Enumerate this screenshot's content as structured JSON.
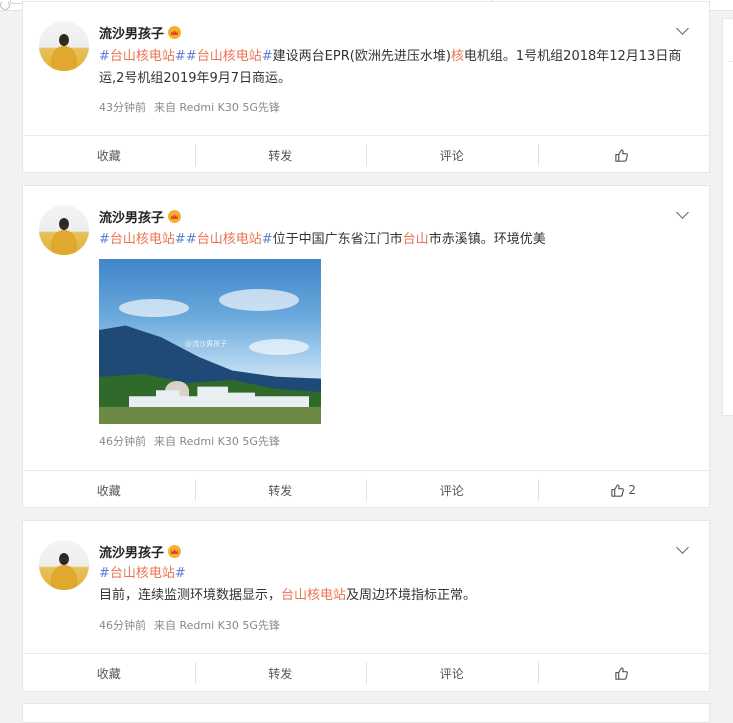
{
  "posts": [
    {
      "user": {
        "name": "流沙男孩子",
        "badge": "crown-badge"
      },
      "text": {
        "t1": "#",
        "t2": "台山核电站",
        "t3": "#",
        "t4": "#",
        "t5": "台山核电站",
        "t6": "#",
        "t7": "建设两台EPR(欧洲先进压水堆)",
        "t8": "核",
        "t9": "电机组。1号机组2018年12月13日商运,2号机组2019年9月7日商运。"
      },
      "time": "43分钟前",
      "source": "来自 Redmi K30 5G先锋",
      "actions": {
        "favorite": "收藏",
        "repost": "转发",
        "comment": "评论",
        "like_count": ""
      }
    },
    {
      "user": {
        "name": "流沙男孩子",
        "badge": "crown-badge"
      },
      "text": {
        "t1": "#",
        "t2": "台山核电站",
        "t3": "#",
        "t4": "#",
        "t5": "台山核电站",
        "t6": "#",
        "t7": "位于中国广东省江门市",
        "t8": "台山",
        "t9": "市赤溪镇。环境优美"
      },
      "image": {
        "watermark": "@流沙男孩子"
      },
      "time": "46分钟前",
      "source": "来自 Redmi K30 5G先锋",
      "actions": {
        "favorite": "收藏",
        "repost": "转发",
        "comment": "评论",
        "like_count": "2"
      }
    },
    {
      "user": {
        "name": "流沙男孩子",
        "badge": "crown-badge"
      },
      "text": {
        "t1": "#",
        "t2": "台山核电站",
        "t3": "#",
        "line2a": "目前，连续监测环境数据显示，",
        "line2b": "台山核电站",
        "line2c": "及周边环境指标正常。"
      },
      "time": "46分钟前",
      "source": "来自 Redmi K30 5G先锋",
      "actions": {
        "favorite": "收藏",
        "repost": "转发",
        "comment": "评论",
        "like_count": ""
      }
    }
  ]
}
